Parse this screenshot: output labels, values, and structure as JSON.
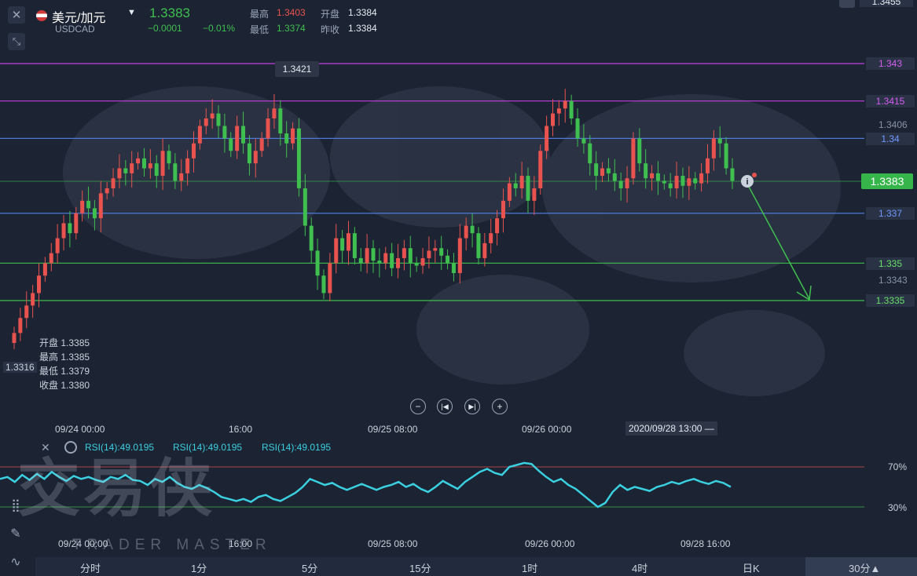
{
  "header": {
    "symbol": "美元/加元",
    "code": "USDCAD",
    "price": "1.3383",
    "change": "−0.0001",
    "change_pct": "−0.01%",
    "high_label": "最高",
    "high_value": "1.3403",
    "low_label": "最低",
    "low_value": "1.3374",
    "open_label": "开盘",
    "open_value": "1.3384",
    "prev_label": "昨收",
    "prev_value": "1.3384",
    "top_right_price": "1.3455"
  },
  "ohlc_tooltip": {
    "open": "开盘 1.3385",
    "high": "最高 1.3385",
    "low": "最低 1.3379",
    "close": "收盘 1.3380"
  },
  "peak_label": "1.3421",
  "left_edge_label": "1.3316",
  "price_levels": [
    {
      "value": "1.343",
      "color": "#c03fe0"
    },
    {
      "value": "1.3415",
      "color": "#c03fe0"
    },
    {
      "value": "1.34",
      "color": "#4d7ad8"
    },
    {
      "value": "1.337",
      "color": "#4d7ad8"
    },
    {
      "value": "1.335",
      "color": "#3fbf4f"
    },
    {
      "value": "1.3335",
      "color": "#3fbf4f"
    }
  ],
  "axis_prices": {
    "p1": "1.3406",
    "p2": "1.3343"
  },
  "current_price_tag": "1.3383",
  "x_axis_main": [
    "09/24 00:00",
    "16:00",
    "09/25 08:00",
    "09/26 00:00"
  ],
  "crosshair_time": "2020/09/28 13:00",
  "rsi": {
    "labels": [
      "RSI(14):49.0195",
      "RSI(14):49.0195",
      "RSI(14):49.0195"
    ],
    "level_70": "70%",
    "level_30": "30%"
  },
  "x_axis_rsi": [
    "09/24 00:00",
    "16:00",
    "09/25 08:00",
    "09/26 00:00",
    "09/28 16:00"
  ],
  "watermark": {
    "cn": "交易侠",
    "en": "TRADER MASTER"
  },
  "timeframes": [
    "分时",
    "1分",
    "5分",
    "15分",
    "1时",
    "4时",
    "日K",
    "30分▲"
  ],
  "colors": {
    "up": "#e8534f",
    "down": "#3fbf4f",
    "rsi": "#3ad0e0",
    "background": "#1c2333"
  },
  "chart_data": {
    "type": "candlestick",
    "series_name": "USDCAD",
    "levels": [
      1.343,
      1.3415,
      1.34,
      1.337,
      1.335,
      1.3335
    ],
    "ylim": [
      1.3316,
      1.3455
    ],
    "closes": [
      1.3322,
      1.3328,
      1.3333,
      1.3338,
      1.3345,
      1.335,
      1.3354,
      1.336,
      1.3366,
      1.3362,
      1.337,
      1.3375,
      1.3372,
      1.3368,
      1.3378,
      1.338,
      1.3384,
      1.3388,
      1.3386,
      1.339,
      1.3392,
      1.3388,
      1.339,
      1.3385,
      1.3395,
      1.339,
      1.3383,
      1.3386,
      1.3392,
      1.3398,
      1.3405,
      1.3408,
      1.341,
      1.3405,
      1.34,
      1.3395,
      1.3405,
      1.3398,
      1.339,
      1.3395,
      1.34,
      1.3408,
      1.3412,
      1.3402,
      1.3398,
      1.3404,
      1.338,
      1.3365,
      1.3355,
      1.3345,
      1.3338,
      1.335,
      1.336,
      1.3355,
      1.3362,
      1.3352,
      1.335,
      1.3356,
      1.3351,
      1.335,
      1.3354,
      1.3348,
      1.3352,
      1.3356,
      1.335,
      1.3349,
      1.3352,
      1.3355,
      1.3356,
      1.3353,
      1.335,
      1.3346,
      1.336,
      1.3365,
      1.3362,
      1.3352,
      1.3358,
      1.3362,
      1.3368,
      1.3375,
      1.3382,
      1.338,
      1.3385,
      1.3375,
      1.338,
      1.3395,
      1.3405,
      1.341,
      1.3412,
      1.3415,
      1.3408,
      1.34,
      1.3398,
      1.339,
      1.3385,
      1.3388,
      1.3386,
      1.3383,
      1.338,
      1.3384,
      1.34,
      1.339,
      1.3384,
      1.3386,
      1.3383,
      1.3382,
      1.338,
      1.3385,
      1.3381,
      1.3384,
      1.3382,
      1.3386,
      1.3392,
      1.34,
      1.3398,
      1.3388,
      1.3383
    ],
    "rsi_values": [
      0.58,
      0.6,
      0.55,
      0.62,
      0.57,
      0.63,
      0.58,
      0.65,
      0.6,
      0.56,
      0.61,
      0.58,
      0.6,
      0.57,
      0.55,
      0.6,
      0.58,
      0.62,
      0.57,
      0.56,
      0.52,
      0.58,
      0.55,
      0.6,
      0.54,
      0.5,
      0.48,
      0.52,
      0.49,
      0.45,
      0.4,
      0.38,
      0.36,
      0.38,
      0.35,
      0.4,
      0.42,
      0.38,
      0.36,
      0.4,
      0.44,
      0.5,
      0.58,
      0.55,
      0.52,
      0.54,
      0.5,
      0.47,
      0.5,
      0.53,
      0.5,
      0.47,
      0.5,
      0.52,
      0.55,
      0.5,
      0.53,
      0.48,
      0.45,
      0.5,
      0.56,
      0.52,
      0.48,
      0.55,
      0.6,
      0.65,
      0.68,
      0.64,
      0.62,
      0.7,
      0.72,
      0.74,
      0.73,
      0.66,
      0.6,
      0.55,
      0.58,
      0.52,
      0.48,
      0.42,
      0.36,
      0.3,
      0.34,
      0.45,
      0.52,
      0.47,
      0.5,
      0.48,
      0.46,
      0.5,
      0.52,
      0.55,
      0.53,
      0.56,
      0.58,
      0.55,
      0.53,
      0.56,
      0.54,
      0.5
    ]
  }
}
